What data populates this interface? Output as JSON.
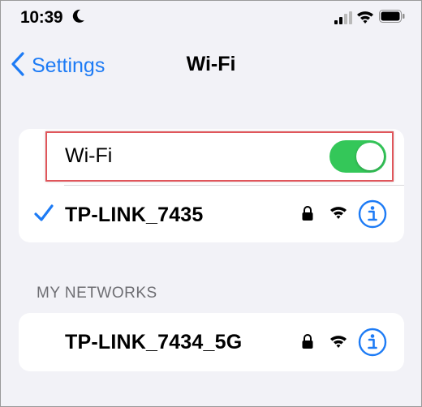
{
  "status_bar": {
    "time": "10:39"
  },
  "nav": {
    "back_label": "Settings",
    "title": "Wi-Fi"
  },
  "wifi_toggle": {
    "label": "Wi-Fi",
    "state": "on"
  },
  "connected_network": {
    "name": "TP-LINK_7435",
    "secured": true,
    "connected": true
  },
  "my_networks": {
    "header": "MY NETWORKS",
    "items": [
      {
        "name": "TP-LINK_7434_5G",
        "secured": true
      }
    ]
  },
  "colors": {
    "accent": "#1d7bf5",
    "toggle_on": "#34c759",
    "highlight_border": "#e0565b",
    "background": "#f2f2f7"
  }
}
